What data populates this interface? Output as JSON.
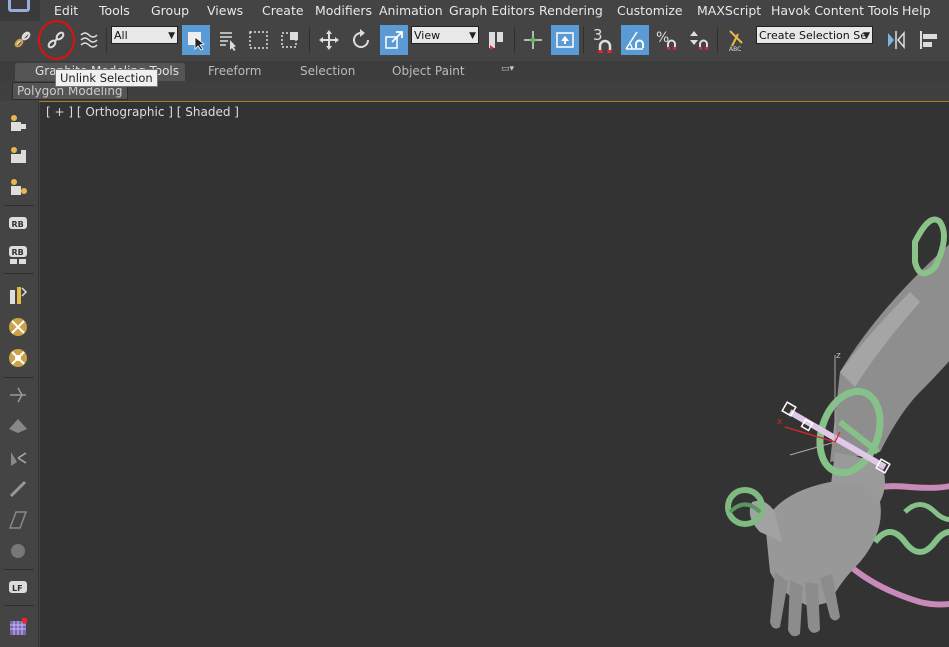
{
  "menu": {
    "items": [
      "Edit",
      "Tools",
      "Group",
      "Views",
      "Create",
      "Modifiers",
      "Animation",
      "Graph Editors",
      "Rendering",
      "Customize",
      "MAXScript",
      "Havok Content Tools",
      "Help"
    ]
  },
  "toolbar": {
    "selection_filter": "All",
    "reference_coord": "View",
    "snap_value": "3",
    "named_selection_placeholder": "Create Selection Se"
  },
  "ribbon": {
    "tabs": [
      "Graphite Modeling Tools",
      "Freeform",
      "Selection",
      "Object Paint"
    ],
    "panel_label": "Polygon Modeling"
  },
  "tooltip": {
    "text": "Unlink Selection"
  },
  "viewport": {
    "label": "[ + ] [ Orthographic ] [ Shaded ]",
    "gizmo_z_label": "z",
    "gizmo_x_label": "x"
  },
  "colors": {
    "highlight_circle": "#e01010",
    "active_button": "#5b9bd5",
    "ribbon_accent": "#a87d20"
  }
}
